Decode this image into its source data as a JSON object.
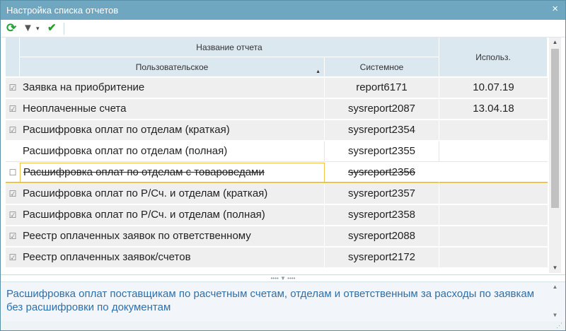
{
  "window": {
    "title": "Настройка списка отчетов",
    "close_glyph": "×"
  },
  "toolbar": {
    "refresh_icon": "⟳",
    "filter_icon": "▼",
    "filter_arrow": "▾",
    "apply_icon": "✔"
  },
  "table": {
    "header": {
      "group": "Название отчета",
      "custom": "Пользовательское",
      "system": "Системное",
      "used": "Использ.",
      "sort_glyph": "▲"
    },
    "rows": [
      {
        "checked": "☑",
        "name": "Заявка на приобритение",
        "system": "report6171",
        "used": "10.07.19"
      },
      {
        "checked": "☑",
        "name": "Неоплаченные счета",
        "system": "sysreport2087",
        "used": "13.04.18"
      },
      {
        "checked": "☑",
        "name": "Расшифровка оплат по отделам (краткая)",
        "system": "sysreport2354",
        "used": ""
      },
      {
        "checked": "",
        "name": "Расшифровка оплат по отделам (полная)",
        "system": "sysreport2355",
        "used": ""
      },
      {
        "checked": "☐",
        "name": "Расшифровка оплат по отделам с товароведами",
        "system": "sysreport2356",
        "used": ""
      },
      {
        "checked": "☑",
        "name": "Расшифровка оплат по Р/Сч. и отделам (краткая)",
        "system": "sysreport2357",
        "used": ""
      },
      {
        "checked": "☑",
        "name": "Расшифровка оплат по Р/Сч. и отделам (полная)",
        "system": "sysreport2358",
        "used": ""
      },
      {
        "checked": "☑",
        "name": "Реестр оплаченных заявок по ответственному",
        "system": "sysreport2088",
        "used": ""
      },
      {
        "checked": "☑",
        "name": "Реестр оплаченных заявок/счетов",
        "system": "sysreport2172",
        "used": ""
      }
    ]
  },
  "scroll": {
    "up": "▲",
    "down": "▼"
  },
  "splitter": {
    "glyph": "•••• ▼ ••••"
  },
  "description": {
    "text": "Расшифровка оплат поставщикам по расчетным счетам, отделам и ответственным за расходы по заявкам без расшифровки по документам"
  },
  "colors": {
    "title_bar": "#6fa7c1",
    "header_bg": "#dce8f0",
    "row_bg": "#efefef",
    "selected_border": "#f0c24a",
    "desc_text": "#2f6fa8"
  }
}
